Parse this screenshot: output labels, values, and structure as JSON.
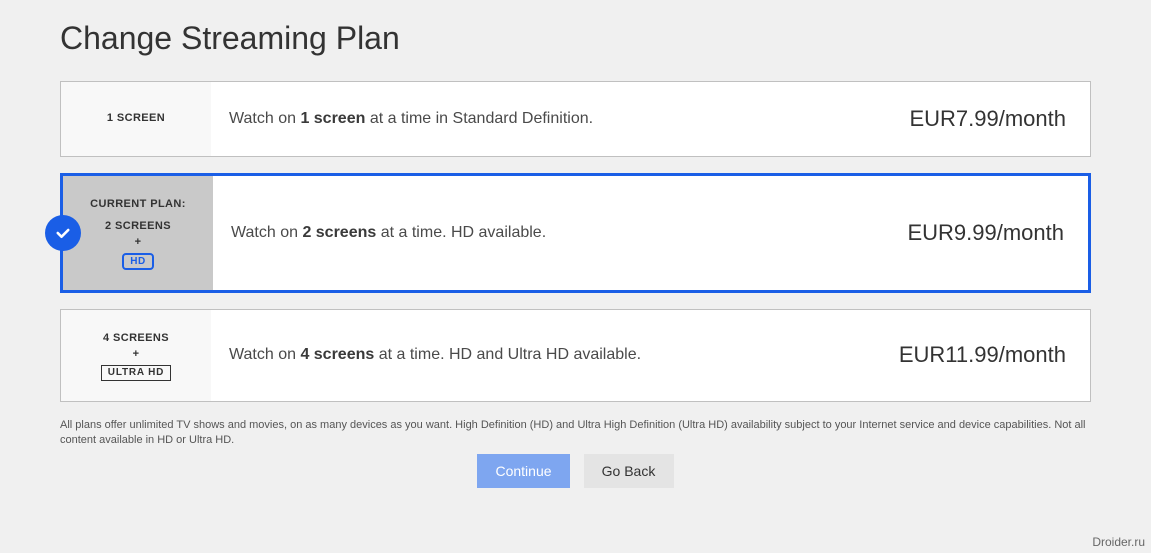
{
  "title": "Change Streaming Plan",
  "current_label": "CURRENT PLAN:",
  "plus": "+",
  "plans": [
    {
      "screens_label": "1 SCREEN",
      "desc_pre": "Watch on ",
      "desc_bold": "1 screen",
      "desc_post": " at a time in Standard Definition.",
      "price": "EUR7.99/month",
      "badge": null,
      "selected": false
    },
    {
      "screens_label": "2 SCREENS",
      "desc_pre": "Watch on ",
      "desc_bold": "2 screens",
      "desc_post": " at a time. HD available.",
      "price": "EUR9.99/month",
      "badge": "HD",
      "selected": true
    },
    {
      "screens_label": "4 SCREENS",
      "desc_pre": "Watch on ",
      "desc_bold": "4 screens",
      "desc_post": " at a time. HD and Ultra HD available.",
      "price": "EUR11.99/month",
      "badge": "ULTRA HD",
      "selected": false
    }
  ],
  "footnote": "All plans offer unlimited TV shows and movies, on as many devices as you want. High Definition (HD) and Ultra High Definition (Ultra HD) availability subject to your Internet service and device capabilities. Not all content available in HD or Ultra HD.",
  "buttons": {
    "continue": "Continue",
    "goback": "Go Back"
  },
  "watermark": "Droider.ru"
}
